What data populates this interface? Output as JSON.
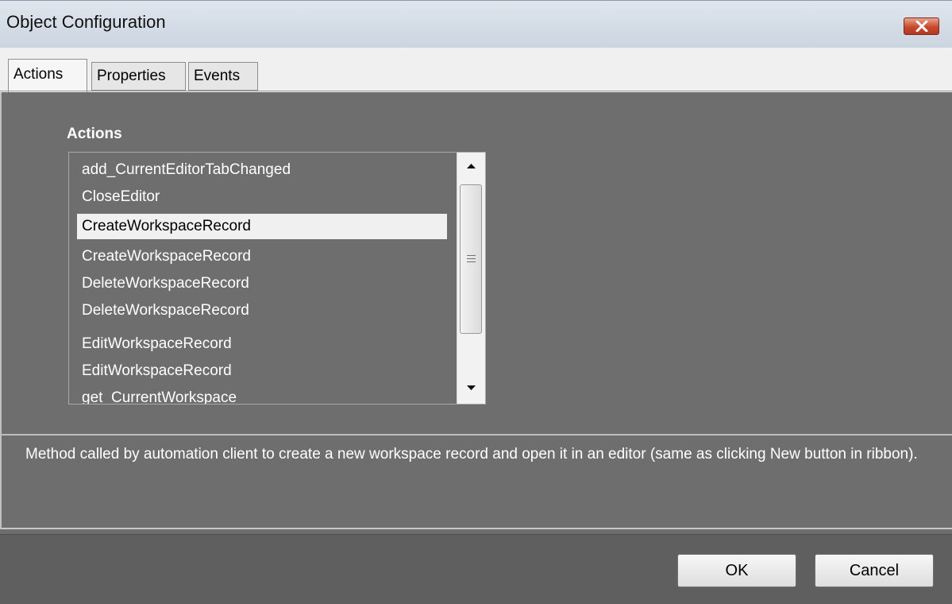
{
  "window": {
    "title": "Object Configuration"
  },
  "tabs": [
    {
      "label": "Actions",
      "active": true
    },
    {
      "label": "Properties",
      "active": false
    },
    {
      "label": "Events",
      "active": false
    }
  ],
  "actions_panel": {
    "heading": "Actions",
    "items": [
      "add_CurrentEditorTabChanged",
      "CloseEditor",
      "CreateWorkspaceRecord",
      "CreateWorkspaceRecord",
      "DeleteWorkspaceRecord",
      "DeleteWorkspaceRecord",
      "EditWorkspaceRecord",
      "EditWorkspaceRecord",
      "get_CurrentWorkspace"
    ],
    "selected_index": 2
  },
  "description": "Method called by automation client to create a new workspace record and open it in an editor (same as clicking New button in ribbon).",
  "buttons": {
    "ok": "OK",
    "cancel": "Cancel"
  },
  "colors": {
    "accent_close": "#c8492c",
    "panel_bg": "#6e6e6e",
    "selection_bg": "#f0f0f0"
  },
  "icons": {
    "close": "close-icon",
    "scroll_up": "chevron-up-icon",
    "scroll_down": "chevron-down-icon"
  }
}
